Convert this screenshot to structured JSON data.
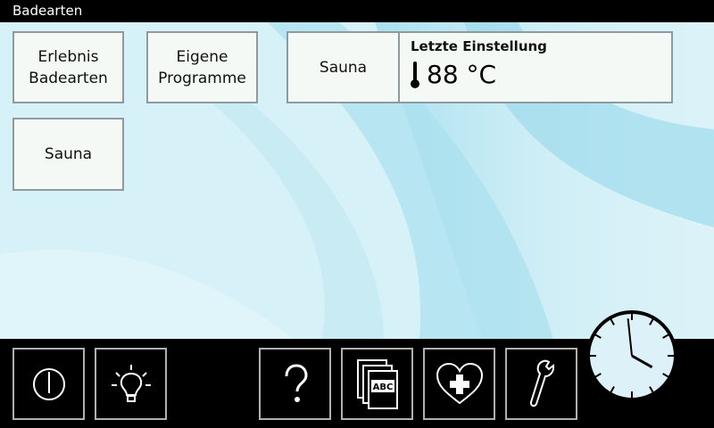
{
  "title": "Badearten",
  "tiles": {
    "erlebnis": "Erlebnis\nBadearten",
    "eigene": "Eigene\nProgramme",
    "sauna": "Sauna"
  },
  "last_setting": {
    "header": "Letzte Einstellung",
    "mode": "Sauna",
    "temperature": "88 °C"
  },
  "toolbar": {
    "power": "power-icon",
    "light": "light-bulb-icon",
    "help": "question-mark-icon",
    "abc_label": "ABC",
    "abc": "documents-abc-icon",
    "health": "heart-plus-icon",
    "service": "wrench-icon"
  },
  "clock": {
    "time": "3:59"
  },
  "colors": {
    "background": "#dff4f9",
    "tile": "#f4f9f5",
    "bar": "#000000"
  }
}
